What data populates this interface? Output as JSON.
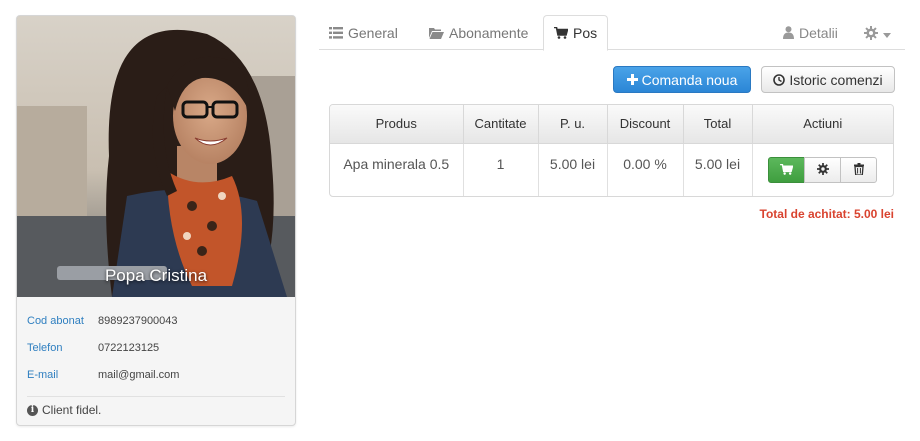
{
  "profile": {
    "name": "Popa Cristina",
    "fields": [
      {
        "label": "Cod abonat",
        "value": "8989237900043"
      },
      {
        "label": "Telefon",
        "value": "0722123125"
      },
      {
        "label": "E-mail",
        "value": "mail@gmail.com"
      }
    ],
    "note": "Client fidel.",
    "note_icon": "info-circle-icon"
  },
  "tabs": [
    {
      "label": "General",
      "icon": "list-icon"
    },
    {
      "label": "Abonamente",
      "icon": "folder-open-icon"
    },
    {
      "label": "Pos",
      "icon": "shopping-cart-icon",
      "active": true
    },
    {
      "label": "Detalii",
      "icon": "user-icon"
    },
    {
      "label": "",
      "icon": "gear-icon",
      "dropdown": true
    }
  ],
  "toolbar": {
    "new_order_label": "Comanda noua",
    "history_label": "Istoric comenzi"
  },
  "table": {
    "headers": [
      "Produs",
      "Cantitate",
      "P. u.",
      "Discount",
      "Total",
      "Actiuni"
    ],
    "rows": [
      {
        "produs": "Apa minerala 0.5",
        "cantitate": "1",
        "pu": "5.00 lei",
        "discount": "0.00 %",
        "total": "5.00 lei"
      }
    ]
  },
  "total_label": "Total de achitat: 5.00 lei",
  "colors": {
    "primary": "#2b86d6",
    "success": "#4cae4c",
    "accent_red": "#d9432f",
    "label_blue": "#2f7fc0"
  }
}
